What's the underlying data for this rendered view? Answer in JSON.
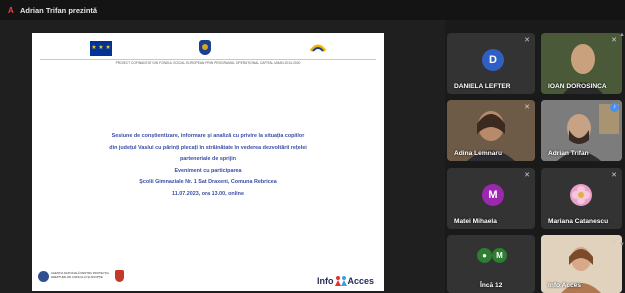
{
  "app": {
    "logo_letter": "A",
    "presenting_text": "Adrian Trifan prezintă"
  },
  "slide": {
    "project_line": "PROIECT COFINANȚAT DIN FONDUL SOCIAL EUROPEAN PRIN PROGRAMUL OPERAȚIONAL CAPITAL UMAN 2014-2020",
    "lines": [
      "Sesiune de conștientizare, informare și analiză cu privire la situația copiilor",
      "din județul Vaslui cu părinți plecați în străinătate în vederea dezvoltării rețelei",
      "parteneriale de sprijin",
      "Eveniment cu participarea",
      "Școlii Gimnaziale Nr. 1 Sat Draxeni, Comuna Rebricea",
      "11.07.2023, ora 13.00, online"
    ],
    "partner_text": "AGENȚIA NAȚIONALĂ PENTRU PROTECȚIA DREPTURILOR COPILULUI ȘI ADOPȚIE",
    "info_acces": {
      "left": "Info",
      "right": "Acces"
    }
  },
  "participants": [
    {
      "name": "DANIELA LEFTER",
      "initial": "D",
      "avatar_color": "#2f5fc4",
      "muted": true
    },
    {
      "name": "IOAN DOROSINCA",
      "muted": true
    },
    {
      "name": "Adina Lemnaru",
      "muted": true
    },
    {
      "name": "Adrian Trifan",
      "speaking": true
    },
    {
      "name": "Matei Mihaela",
      "initial": "M",
      "avatar_color": "#9c27b0",
      "muted": true
    },
    {
      "name": "Mariana Catanescu",
      "muted": true
    },
    {
      "name": "Încă 12",
      "initial": "M",
      "avatar_color": "#2e7d32"
    },
    {
      "name": "Info Acces",
      "muted": true
    }
  ],
  "colors": {
    "accent": "#4a8ef0",
    "slide_text": "#3b4ea6",
    "app_logo": "#e8453c"
  }
}
